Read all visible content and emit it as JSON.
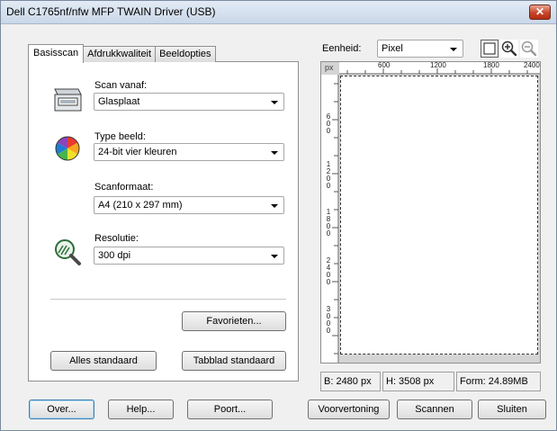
{
  "window": {
    "title": "Dell C1765nf/nfw MFP TWAIN Driver (USB)",
    "close_glyph": "✕"
  },
  "tabs": [
    {
      "label": "Basisscan"
    },
    {
      "label": "Afdrukkwaliteit"
    },
    {
      "label": "Beeldopties"
    }
  ],
  "basic": {
    "scan_from_label": "Scan vanaf:",
    "scan_from_value": "Glasplaat",
    "image_type_label": "Type beeld:",
    "image_type_value": "24-bit vier kleuren",
    "scan_size_label": "Scanformaat:",
    "scan_size_value": "A4 (210 x 297 mm)",
    "resolution_label": "Resolutie:",
    "resolution_value": "300 dpi",
    "favorites_label": "Favorieten...",
    "all_default_label": "Alles standaard",
    "tab_default_label": "Tabblad standaard"
  },
  "preview": {
    "unit_label": "Eenheid:",
    "unit_value": "Pixel",
    "ruler_unit": "px",
    "top_ticks": [
      "600",
      "1200",
      "1800",
      "2400"
    ],
    "left_ticks": [
      "600",
      "1200",
      "1800",
      "2400",
      "3000"
    ],
    "status_width": "B: 2480 px",
    "status_height": "H: 3508 px",
    "status_form": "Form: 24.89MB"
  },
  "footer": {
    "about_label": "Over...",
    "help_label": "Help...",
    "port_label": "Poort...",
    "preview_label": "Voorvertoning",
    "scan_label": "Scannen",
    "close_label": "Sluiten"
  }
}
